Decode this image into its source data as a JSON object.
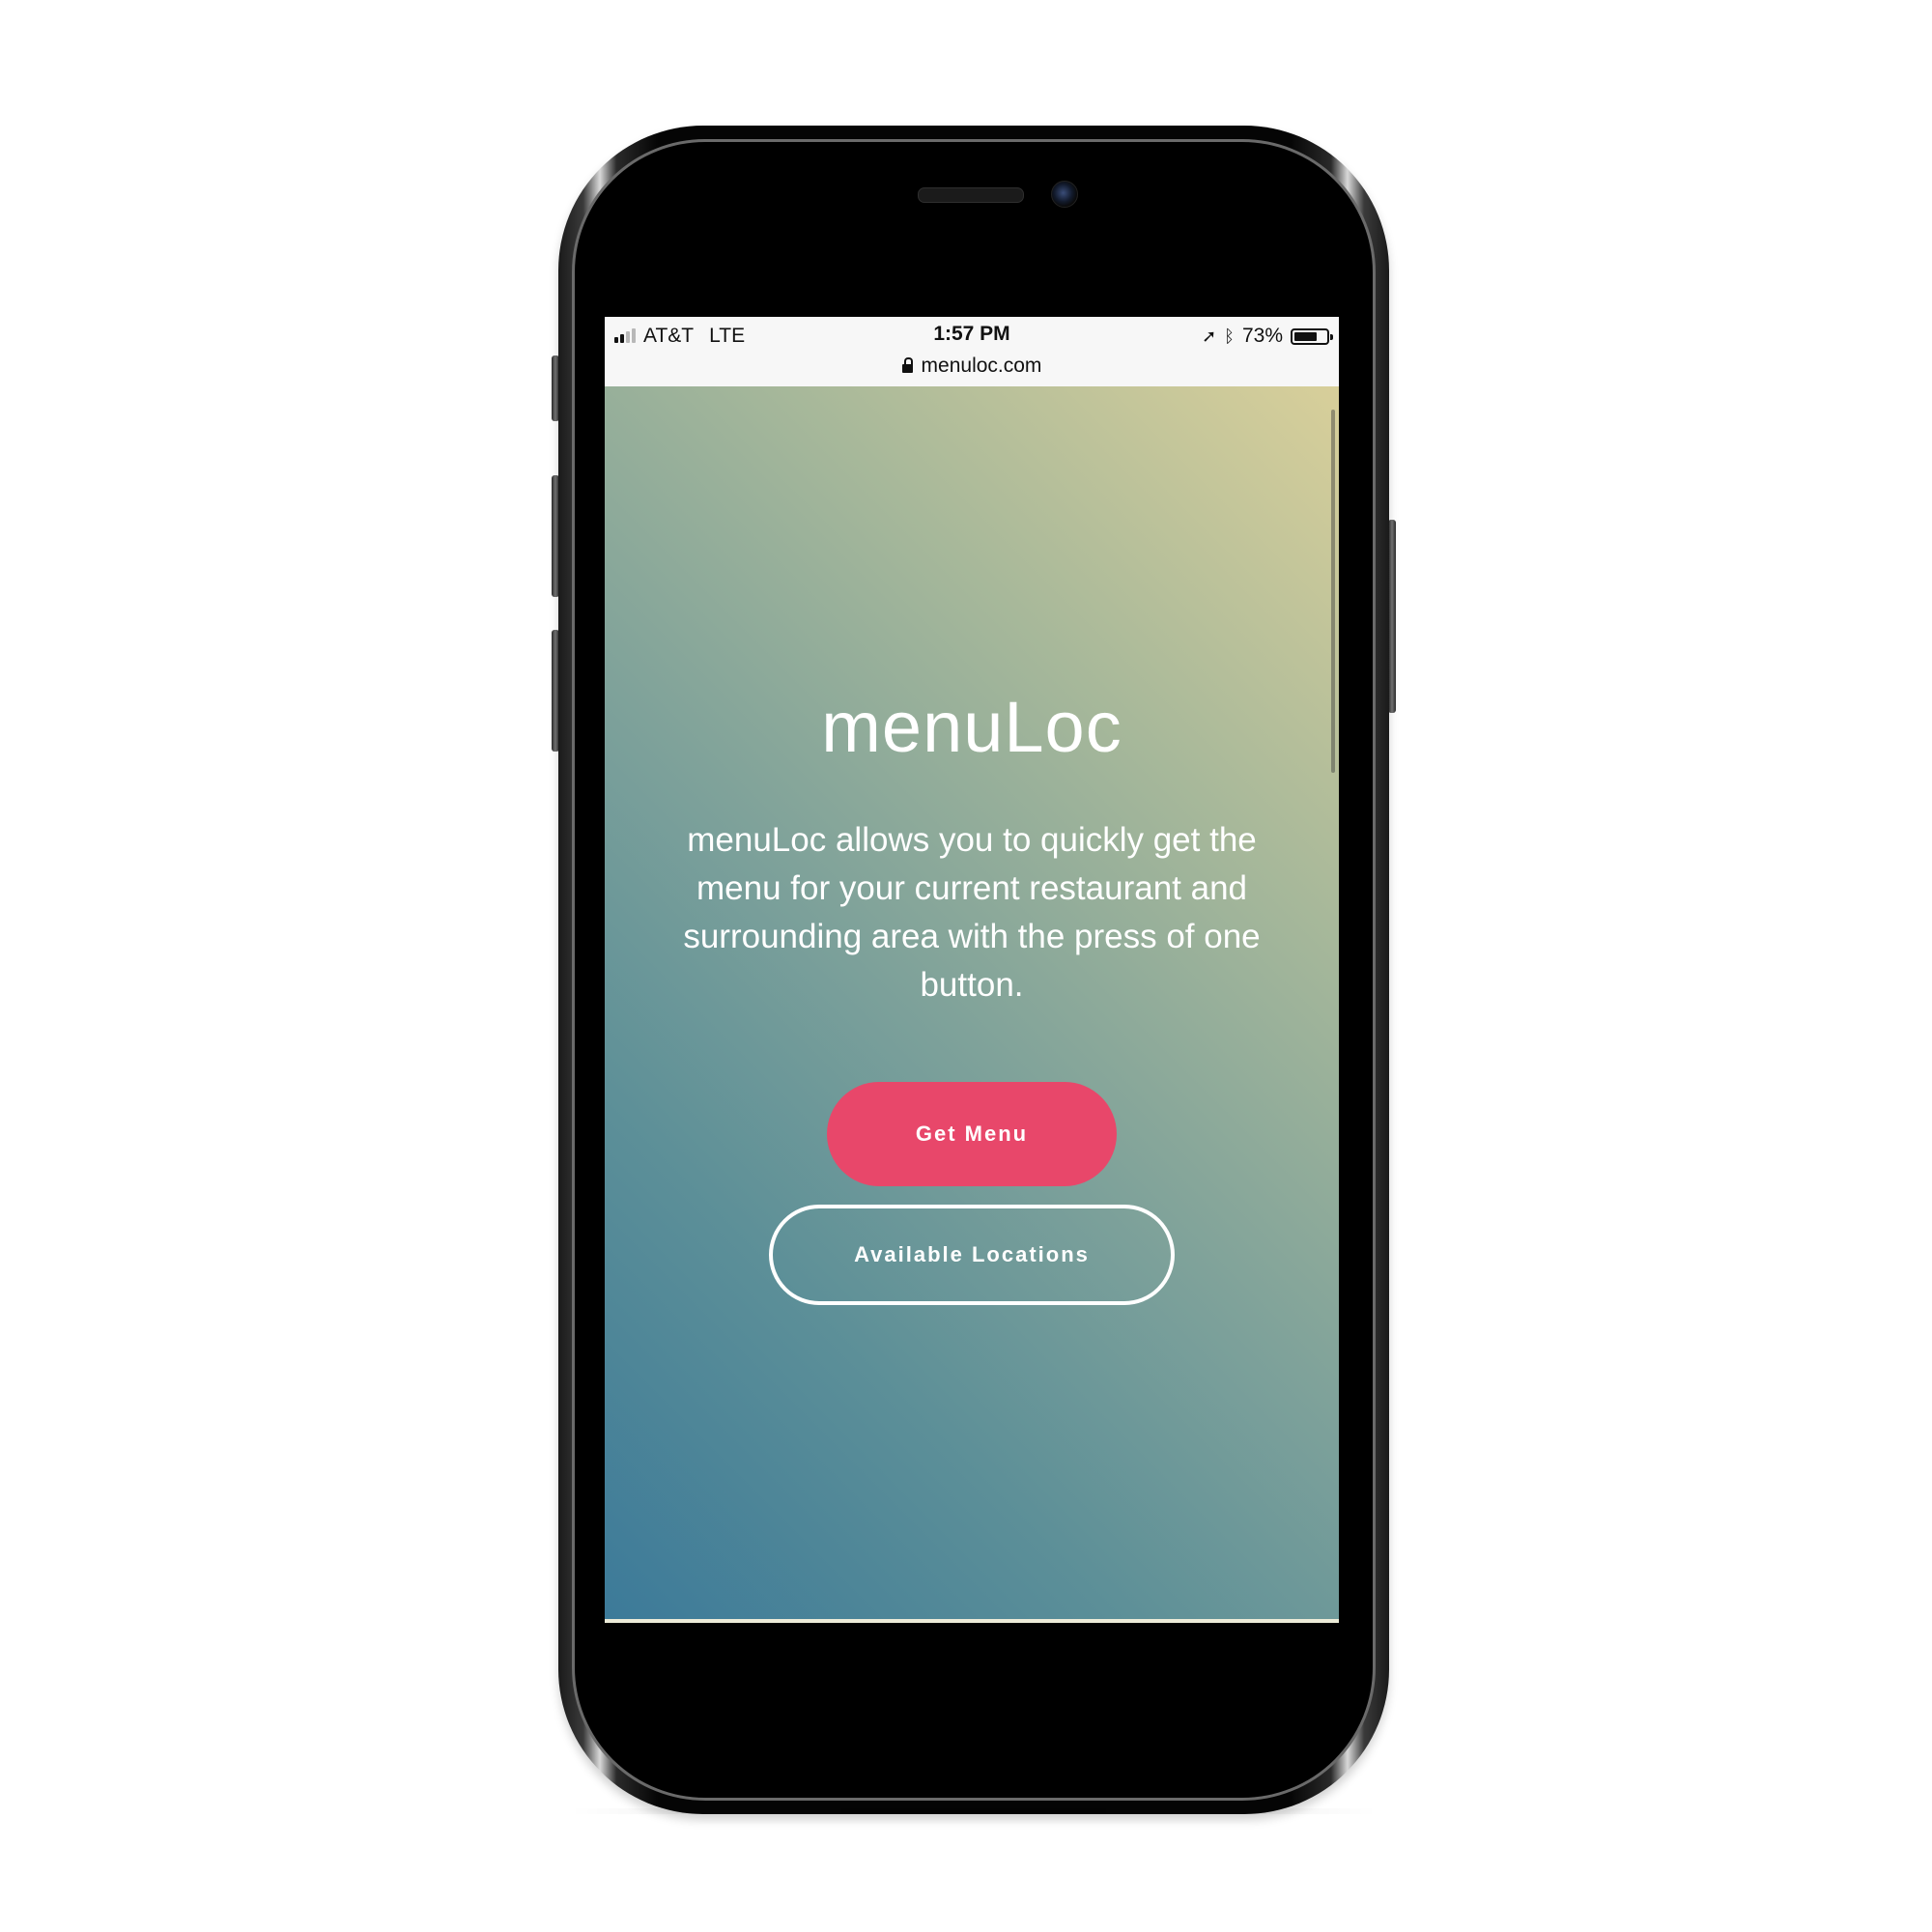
{
  "statusbar": {
    "carrier": "AT&T",
    "network": "LTE",
    "time": "1:57 PM",
    "battery_percent": "73%",
    "battery_level": 0.73,
    "signal_bars_total": 4,
    "signal_bars_active": 2,
    "url": "menuloc.com"
  },
  "hero": {
    "title": "menuLoc",
    "description": "menuLoc allows you to quickly get the menu for your current restaurant and surrounding area with the press of one button."
  },
  "actions": {
    "primary_label": "Get Menu",
    "secondary_label": "Available Locations"
  },
  "colors": {
    "primary_button": "#e8476a",
    "gradient_top_right": "#d8cf9a",
    "gradient_bottom_left": "#3c7a99",
    "text_on_gradient": "#ffffff",
    "phone_frame": "#050505"
  },
  "icons": {
    "signal": "signal-bars-icon",
    "location": "location-arrow-icon",
    "bluetooth": "bluetooth-icon",
    "battery": "battery-icon",
    "lock": "lock-icon"
  }
}
